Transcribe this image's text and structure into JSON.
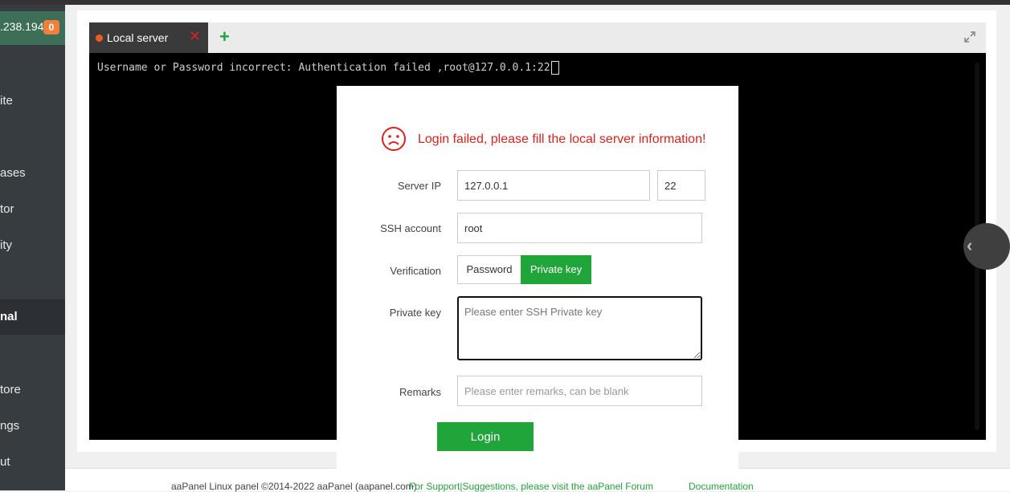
{
  "sidebar": {
    "ip": ".238.194",
    "badge": "0",
    "items": [
      "ite",
      "ases",
      "tor",
      "ity",
      "nal",
      "tore",
      "ngs",
      "ut"
    ],
    "active_index": 4
  },
  "tabs": {
    "active_label": "Local server",
    "close_icon": "close-icon",
    "add_icon": "plus-icon",
    "expand_icon": "expand-icon"
  },
  "terminal": {
    "text": "Username or Password incorrect: Authentication failed ,root@127.0.0.1:22"
  },
  "dialog": {
    "icon": "sad-face-icon",
    "message": "Login failed, please fill the local server information!",
    "server_ip_label": "Server IP",
    "server_ip_value": "127.0.0.1",
    "port_value": "22",
    "ssh_account_label": "SSH account",
    "ssh_account_value": "root",
    "verification_label": "Verification",
    "verification_options": [
      "Password",
      "Private key"
    ],
    "verification_selected": "Private key",
    "private_key_label": "Private key",
    "private_key_placeholder": "Please enter SSH Private key",
    "remarks_label": "Remarks",
    "remarks_placeholder": "Please enter remarks, can be blank",
    "login_button": "Login"
  },
  "footer": {
    "copyright": "aaPanel Linux panel ©2014-2022 aaPanel (aapanel.com)",
    "support_link": "For Support|Suggestions, please visit the aaPanel Forum",
    "docs_link": "Documentation"
  },
  "colors": {
    "accent": "#20a53a",
    "error": "#e0201a",
    "sidebar_bg": "#363c40",
    "terminal_bg": "#000000"
  }
}
